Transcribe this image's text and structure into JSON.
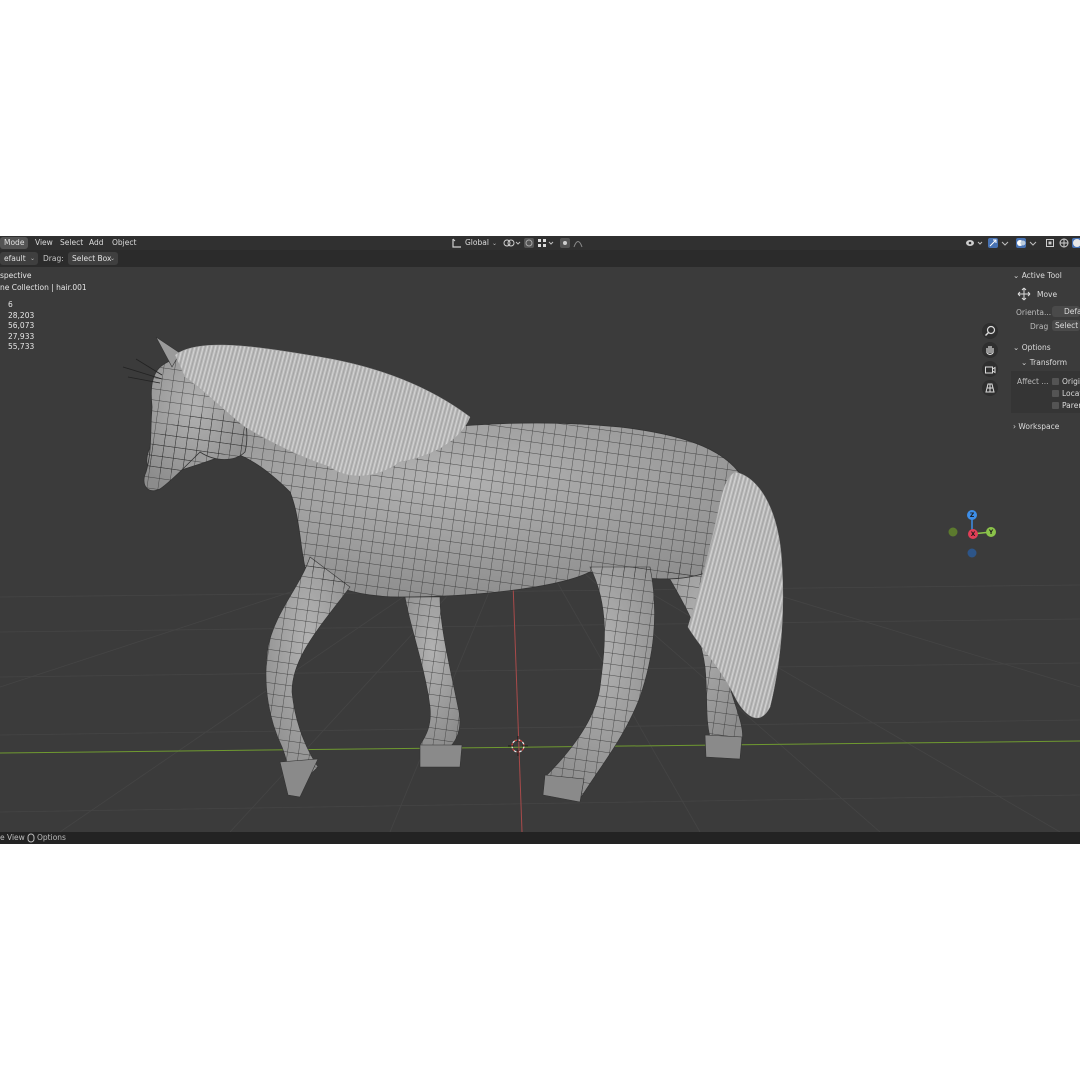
{
  "header": {
    "mode_label": "Mode",
    "menus": [
      "View",
      "Select",
      "Add",
      "Object"
    ],
    "orientation": "Global"
  },
  "toolbar": {
    "orientation_value": "efault",
    "drag_label": "Drag:",
    "drag_value": "Select Box"
  },
  "overlay": {
    "view_name": "spective",
    "collection": "ne Collection | hair.001",
    "stats": [
      "6",
      "28,203",
      "56,073",
      "27,933",
      "55,733"
    ]
  },
  "gizmo": {
    "z": "Z",
    "y": "Y",
    "x": "X"
  },
  "npanel": {
    "active_tool_header": "Active Tool",
    "tool_name": "Move",
    "orientation_label": "Orienta...",
    "orientation_value": "Defa",
    "drag_label": "Drag",
    "drag_value": "Select B",
    "options_header": "Options",
    "transform_header": "Transform",
    "affect_label": "Affect ...",
    "affect_items": [
      "Origin",
      "Locat",
      "Paren"
    ],
    "workspace_header": "Workspace"
  },
  "status": {
    "left_text": "e View",
    "options_text": "Options"
  },
  "colors": {
    "x_axis": "#e23e57",
    "y_axis": "#8bc34a",
    "z_axis": "#3d8ee8",
    "background": "#3b3b3b"
  }
}
